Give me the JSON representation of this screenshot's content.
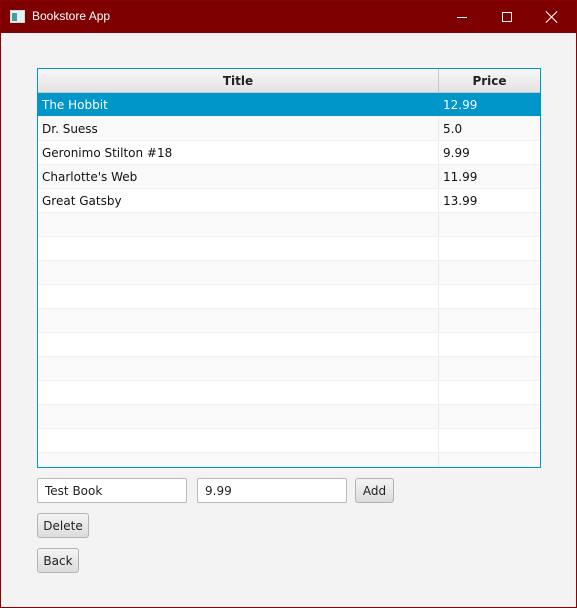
{
  "window": {
    "title": "Bookstore App"
  },
  "table": {
    "columns": [
      "Title",
      "Price"
    ],
    "rows": [
      {
        "title": "The Hobbit",
        "price": "12.99",
        "selected": true
      },
      {
        "title": "Dr. Suess",
        "price": "5.0",
        "selected": false
      },
      {
        "title": "Geronimo Stilton #18",
        "price": "9.99",
        "selected": false
      },
      {
        "title": "Charlotte's Web",
        "price": "11.99",
        "selected": false
      },
      {
        "title": "Great Gatsby",
        "price": "13.99",
        "selected": false
      }
    ],
    "empty_rows": 11
  },
  "form": {
    "title_value": "Test Book",
    "price_value": "9.99",
    "add_label": "Add",
    "delete_label": "Delete",
    "back_label": "Back"
  },
  "colors": {
    "titlebar": "#7f0000",
    "selection": "#0096c9"
  }
}
